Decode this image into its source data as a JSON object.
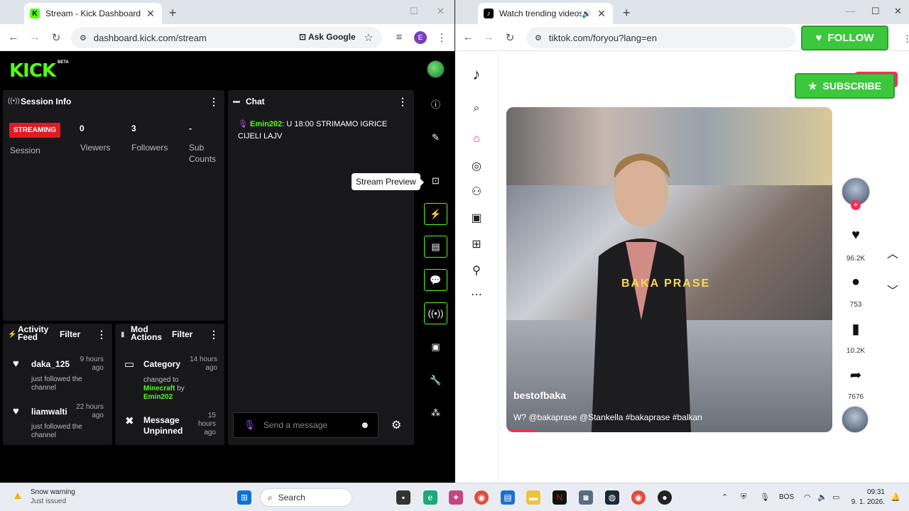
{
  "left_browser": {
    "tab_title": "Stream - Kick Dashboard",
    "url": "dashboard.kick.com/stream",
    "ask_google": "Ask Google",
    "profile_initial": "E"
  },
  "kick": {
    "logo": "KICK",
    "beta": "BETA",
    "session_info": {
      "title": "Session Info",
      "status": "STREAMING",
      "session_label": "Session",
      "viewers_value": "0",
      "viewers_label": "Viewers",
      "followers_value": "3",
      "followers_label": "Followers",
      "subs_value": "-",
      "subs_label_1": "Sub",
      "subs_label_2": "Counts"
    },
    "chat": {
      "title": "Chat",
      "message_user": "Emin202",
      "message_text": ": U 18:00 STRIMAMO IGRICE CIJELI LAJV",
      "input_placeholder": "Send a message"
    },
    "tooltip": "Stream Preview",
    "activity_feed": {
      "title_1": "Activity",
      "title_2": "Feed",
      "filter": "Filter",
      "items": [
        {
          "name": "daka_125",
          "time_1": "9 hours",
          "time_2": "ago",
          "desc_1": "just followed the",
          "desc_2": "channel"
        },
        {
          "name": "liamwalti",
          "time_1": "22 hours",
          "time_2": "ago",
          "desc_1": "just followed the",
          "desc_2": "channel"
        }
      ]
    },
    "mod_actions": {
      "title_1": "Mod",
      "title_2": "Actions",
      "filter": "Filter",
      "items": [
        {
          "name": "Category",
          "time_1": "14 hours",
          "time_2": "ago",
          "desc_1": "changed to",
          "desc_game": "Minecraft",
          "desc_by": " by",
          "desc_user": "Emin202"
        },
        {
          "name_1": "Message",
          "name_2": "Unpinned",
          "time_1": "15",
          "time_2": "hours",
          "time_3": "ago"
        }
      ]
    }
  },
  "right_browser": {
    "tab_title": "Watch trending videos for y",
    "url": "tiktok.com/foryou?lang=en"
  },
  "tiktok": {
    "overlay_text": "BAKA PRASE",
    "author": "bestofbaka",
    "caption": "W? @bakaprase @Stankella #bakaprase #balkan",
    "likes": "96.2K",
    "comments": "753",
    "bookmarks": "10.2K",
    "shares": "7676",
    "follow_overlay": "FOLLOW",
    "subscribe_overlay": "SUBSCRIBE"
  },
  "taskbar": {
    "weather_title": "Snow warning",
    "weather_sub": "Just issued",
    "search": "Search",
    "lang": "BOS",
    "time": "09:31",
    "date": "9. 1. 2026."
  },
  "colors": {
    "kick_green": "#53fc18",
    "streaming_red": "#e01b24",
    "tiktok_pink": "#fe2c55",
    "overlay_green": "#3cc83c"
  }
}
